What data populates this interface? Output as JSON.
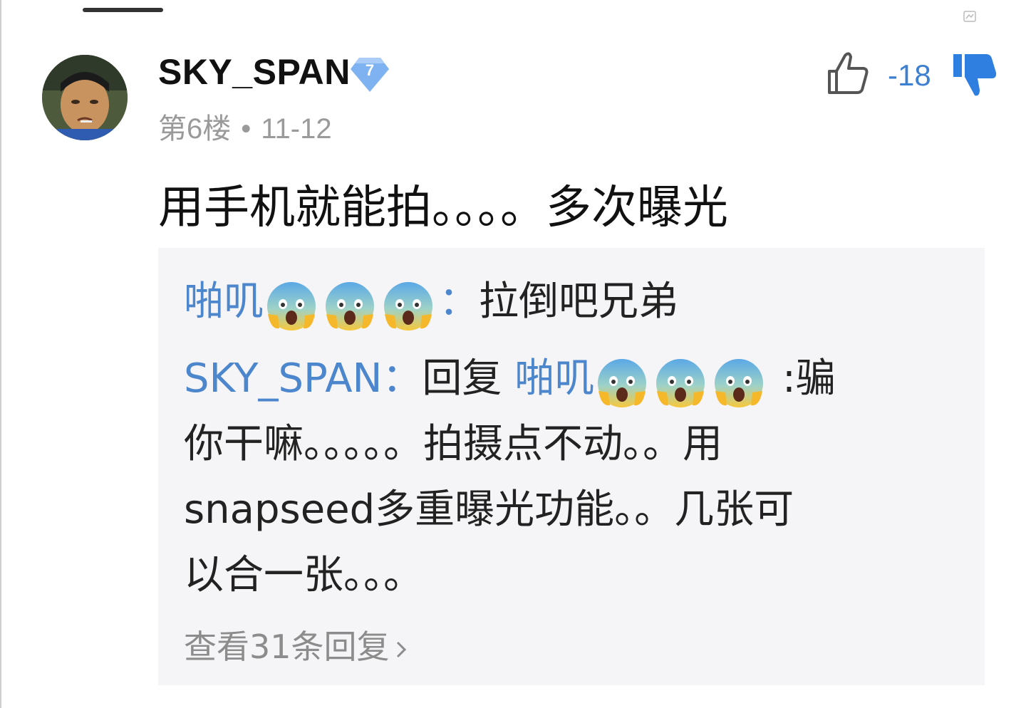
{
  "post": {
    "username": "SKY_SPAN",
    "level": "7",
    "floor": "第6楼",
    "separator": "•",
    "date": "11-12",
    "vote_count": "-18",
    "content": "用手机就能拍。。。。多次曝光"
  },
  "replies": {
    "r1_author": "啪叽",
    "r1_colon": "：",
    "r1_text": "拉倒吧兄弟",
    "r2_author": "SKY_SPAN：",
    "r2_reply_word": "回复 ",
    "r2_target": "啪叽",
    "r2_text_first": " :骗",
    "r2_line2": "你干嘛。。。。。拍摄点不动。。用",
    "r2_line3": "snapseed多重曝光功能。。几张可",
    "r2_line4": "以合一张。。。",
    "view_more": "查看31条回复"
  },
  "icons": {
    "like": "thumbs-up-outline-icon",
    "dislike": "thumbs-down-filled-icon",
    "badge": "level-diamond-icon",
    "emoji": "fearful-screaming-face-emoji",
    "more": "chevron-right-icon"
  },
  "colors": {
    "accent_blue": "#3d7fd0",
    "name_blue": "#4c86cc",
    "meta_gray": "#9a9a9a",
    "reply_bg": "#f5f4f6"
  }
}
